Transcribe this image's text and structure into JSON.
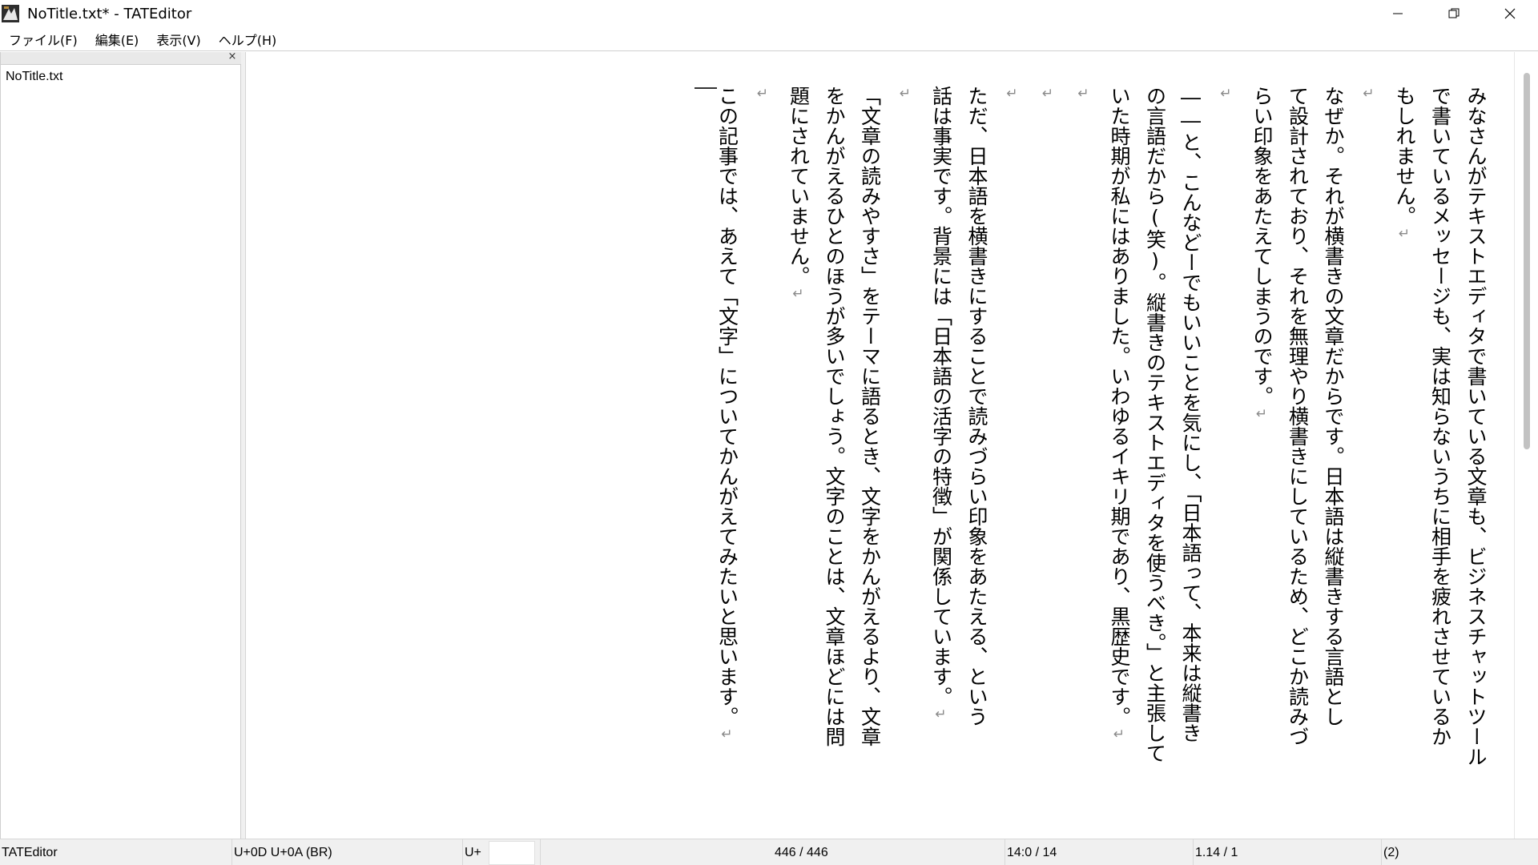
{
  "window": {
    "title": "NoTitle.txt* - TATEditor",
    "controls": [
      "minimize",
      "restore",
      "close"
    ]
  },
  "menu": {
    "items": [
      "ファイル(F)",
      "編集(E)",
      "表示(V)",
      "ヘルプ(H)"
    ]
  },
  "files_pane": {
    "files": [
      "NoTitle.txt"
    ]
  },
  "editor": {
    "lines": [
      "みなさんがテキストエディタで書いている文章も、ビジネスチャットツール",
      "で書いているメッセージも、実は知らないうちに相手を疲れさせているか",
      "もしれません。",
      "",
      "なぜか。それが横書きの文章だからです。日本語は縦書きする言語とし",
      "て設計されており、それを無理やり横書きにしているため、どこか読みづ",
      "らい印象をあたえてしまうのです。",
      "",
      "――と、こんなどーでもいいことを気にし、「日本語って、本来は縦書き",
      "の言語だから(笑)。縦書きのテキストエディタを使うべき。」と主張して",
      "いた時期が私にはありました。いわゆるイキリ期であり、黒歴史です。",
      "",
      "",
      "",
      "ただ、日本語を横書きにすることで読みづらい印象をあたえる、という",
      "話は事実です。背景には「日本語の活字の特徴」が関係しています。",
      "",
      "「文章の読みやすさ」をテーマに語るとき、文字をかんがえるより、文章",
      "をかんがえるひとのほうが多いでしょう。文字のことは、文章ほどには問",
      "題にされていません。",
      "",
      "この記事では、あえて「文字」についてかんがえてみたいと思います。"
    ],
    "line_end_marks": [
      false,
      false,
      true,
      true,
      false,
      false,
      true,
      true,
      false,
      false,
      true,
      true,
      true,
      true,
      false,
      true,
      true,
      false,
      false,
      true,
      true,
      true
    ],
    "newline_mark": "↵"
  },
  "status_bar": {
    "app": "TATEditor",
    "char_code": "U+0D U+0A (BR)",
    "unicode_prefix": "U+",
    "char_count": "446 / 446",
    "position": "14:0 / 14",
    "zoom": "1.14 / 1",
    "extra": "(2)"
  }
}
